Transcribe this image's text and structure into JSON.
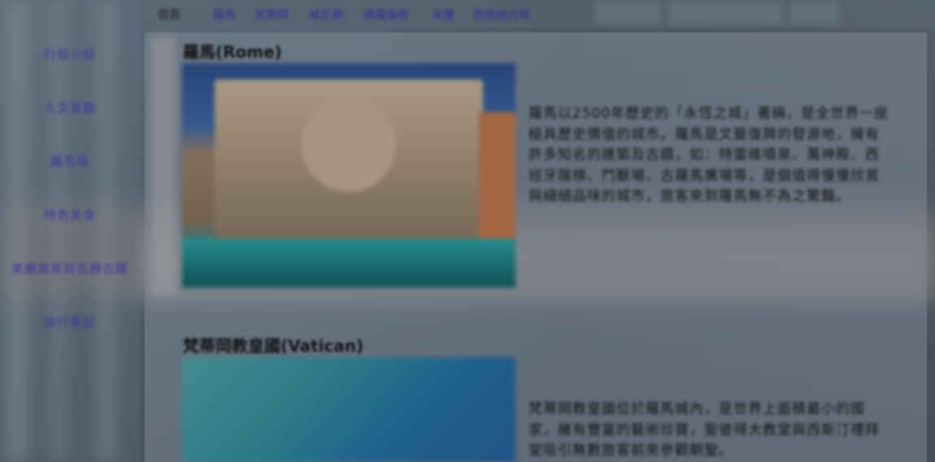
{
  "sidebar": {
    "items": [
      {
        "label": "行程介紹"
      },
      {
        "label": "人文景觀"
      },
      {
        "label": "羅馬地"
      },
      {
        "label": "特色美食"
      },
      {
        "label": "美麗風景與名勝古蹟"
      },
      {
        "label": "旅行筆記"
      }
    ]
  },
  "topnav": {
    "home": "首頁",
    "items": [
      {
        "label": "羅馬"
      },
      {
        "label": "梵蒂岡"
      },
      {
        "label": "威尼斯"
      },
      {
        "label": "佛羅倫斯"
      },
      {
        "label": "米蘭"
      },
      {
        "label": "西恩納古城"
      }
    ]
  },
  "sections": [
    {
      "title": "羅馬(Rome)",
      "paragraph": "羅馬以2500年歷史的「永恆之城」著稱，是全世界一座極具歷史價值的城市。羅馬是文藝復興的發源地，擁有許多知名的建築及古蹟，如：特雷維噴泉、萬神殿、西班牙階梯、鬥獸場、古羅馬廣場等，是個值得慢慢欣賞與細細品味的城市，旅客來到羅馬無不為之驚豔。"
    },
    {
      "title": "梵蒂岡教皇國(Vatican)",
      "paragraph": "梵蒂岡教皇國位於羅馬城內，是世界上面積最小的國家，擁有豐富的藝術珍寶，聖彼得大教堂與西斯汀禮拜堂吸引無數旅客前來參觀朝聖。"
    }
  ]
}
